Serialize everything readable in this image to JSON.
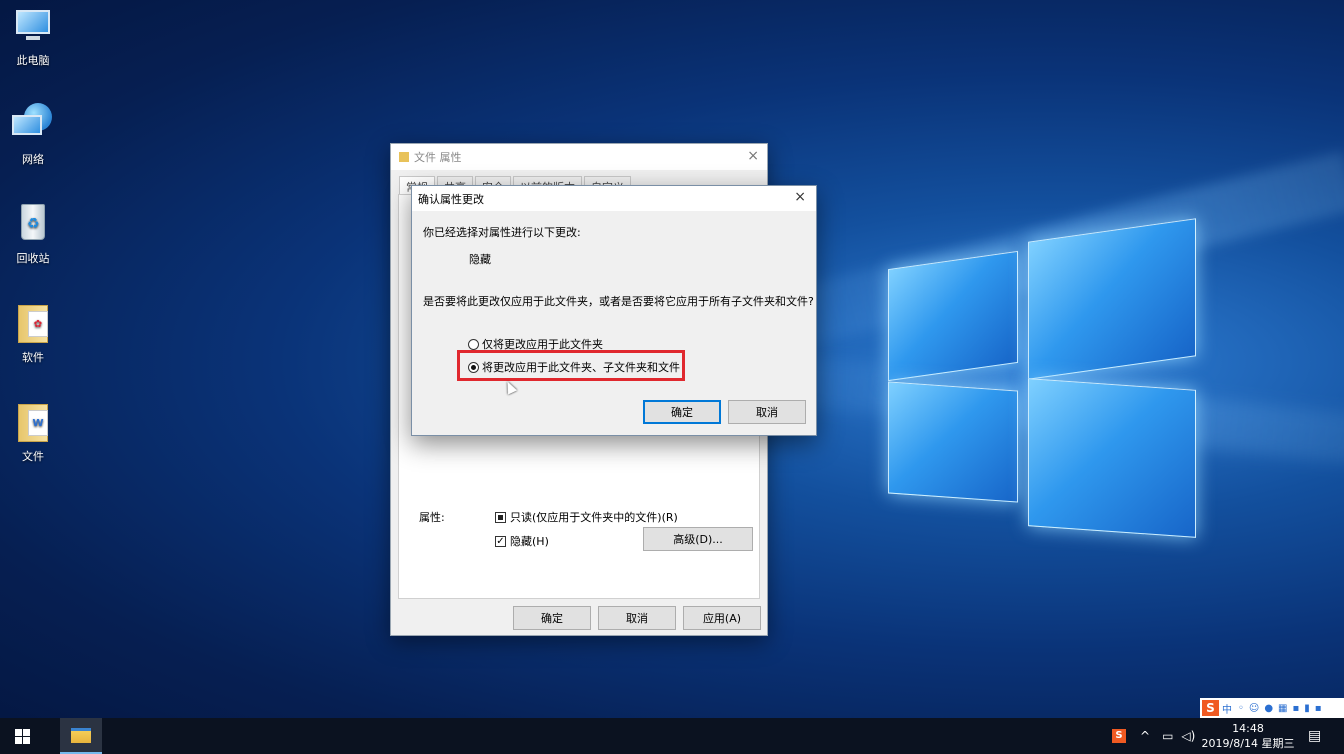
{
  "desktop": {
    "icons": [
      {
        "label": "此电脑",
        "icon": "this-pc-icon"
      },
      {
        "label": "网络",
        "icon": "network-icon"
      },
      {
        "label": "回收站",
        "icon": "recycle-bin-icon"
      },
      {
        "label": "软件",
        "icon": "folder-icon"
      },
      {
        "label": "文件",
        "icon": "folder-icon"
      }
    ]
  },
  "properties_window": {
    "title": "文件 属性",
    "tabs": [
      "常规",
      "共享",
      "安全",
      "以前的版本",
      "自定义"
    ],
    "attributes_label": "属性:",
    "readonly_label": "只读(仅应用于文件夹中的文件)(R)",
    "hidden_label": "隐藏(H)",
    "hidden_checked": true,
    "readonly_state": "indeterminate",
    "advanced_button": "高级(D)...",
    "ok_button": "确定",
    "cancel_button": "取消",
    "apply_button": "应用(A)"
  },
  "confirm_dialog": {
    "title": "确认属性更改",
    "close": "×",
    "intro": "你已经选择对属性进行以下更改:",
    "change": "隐藏",
    "question": "是否要将此更改仅应用于此文件夹，或者是否要将它应用于所有子文件夹和文件?",
    "option1": "仅将更改应用于此文件夹",
    "option2": "将更改应用于此文件夹、子文件夹和文件",
    "selected_option": 2,
    "ok_button": "确定",
    "cancel_button": "取消",
    "highlight_color": "#e0282e"
  },
  "taskbar": {
    "time": "14:48",
    "date": "2019/8/14 星期三",
    "ime_label": "中",
    "ime_icon": "S"
  }
}
